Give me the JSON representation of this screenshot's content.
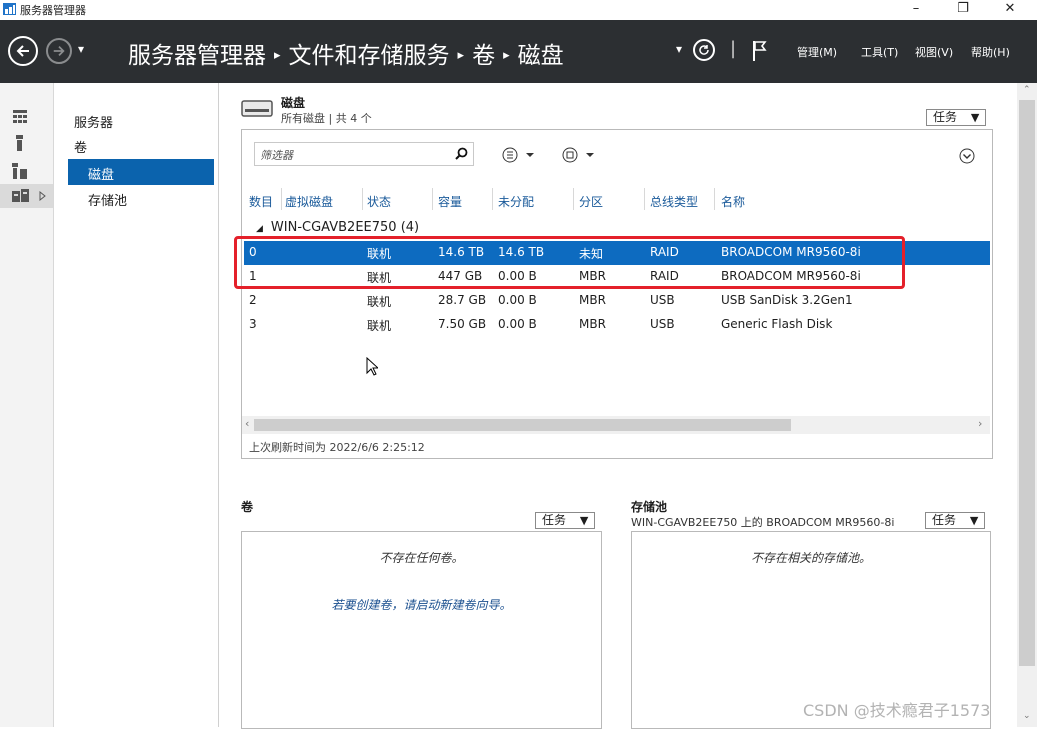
{
  "window": {
    "title": "服务器管理器",
    "minimize": "–",
    "restore": "❐",
    "close": "✕"
  },
  "header": {
    "breadcrumb": [
      "服务器管理器",
      "文件和存储服务",
      "卷",
      "磁盘"
    ],
    "breadcrumb_sep": "▸",
    "menus": [
      "管理(M)",
      "工具(T)",
      "视图(V)",
      "帮助(H)"
    ],
    "dropdown_arrow": "▾",
    "pipe": "|"
  },
  "nav": {
    "items": [
      "服务器",
      "卷",
      "磁盘",
      "存储池"
    ],
    "selected_index": 2
  },
  "disks": {
    "title": "磁盘",
    "subtitle": "所有磁盘 | 共 4 个",
    "tasks_label": "任务",
    "filter_placeholder": "筛选器",
    "columns": [
      "数目",
      "虚拟磁盘",
      "状态",
      "容量",
      "未分配",
      "分区",
      "总线类型",
      "名称"
    ],
    "group": "WIN-CGAVB2EE750 (4)",
    "rows": [
      {
        "num": "0",
        "virtual": "",
        "status": "联机",
        "capacity": "14.6 TB",
        "unallocated": "14.6 TB",
        "partition": "未知",
        "bus": "RAID",
        "name": "BROADCOM MR9560-8i"
      },
      {
        "num": "1",
        "virtual": "",
        "status": "联机",
        "capacity": "447 GB",
        "unallocated": "0.00 B",
        "partition": "MBR",
        "bus": "RAID",
        "name": "BROADCOM MR9560-8i"
      },
      {
        "num": "2",
        "virtual": "",
        "status": "联机",
        "capacity": "28.7 GB",
        "unallocated": "0.00 B",
        "partition": "MBR",
        "bus": "USB",
        "name": "USB SanDisk 3.2Gen1"
      },
      {
        "num": "3",
        "virtual": "",
        "status": "联机",
        "capacity": "7.50 GB",
        "unallocated": "0.00 B",
        "partition": "MBR",
        "bus": "USB",
        "name": "Generic Flash Disk"
      }
    ],
    "selected_row": 0,
    "refresh": "上次刷新时间为 2022/6/6 2:25:12"
  },
  "volumes": {
    "title": "卷",
    "tasks_label": "任务",
    "empty": "不存在任何卷。",
    "hint": "若要创建卷，请启动新建卷向导。"
  },
  "pools": {
    "title": "存储池",
    "subtitle": "WIN-CGAVB2EE750 上的 BROADCOM MR9560-8i",
    "tasks_label": "任务",
    "empty": "不存在相关的存储池。"
  },
  "watermark": "CSDN @技术瘾君子1573",
  "colors": {
    "header_bg": "#2c2f32",
    "selection": "#0d6bc0",
    "nav_selected": "#0b63ad",
    "highlight_box": "#e4202a"
  }
}
